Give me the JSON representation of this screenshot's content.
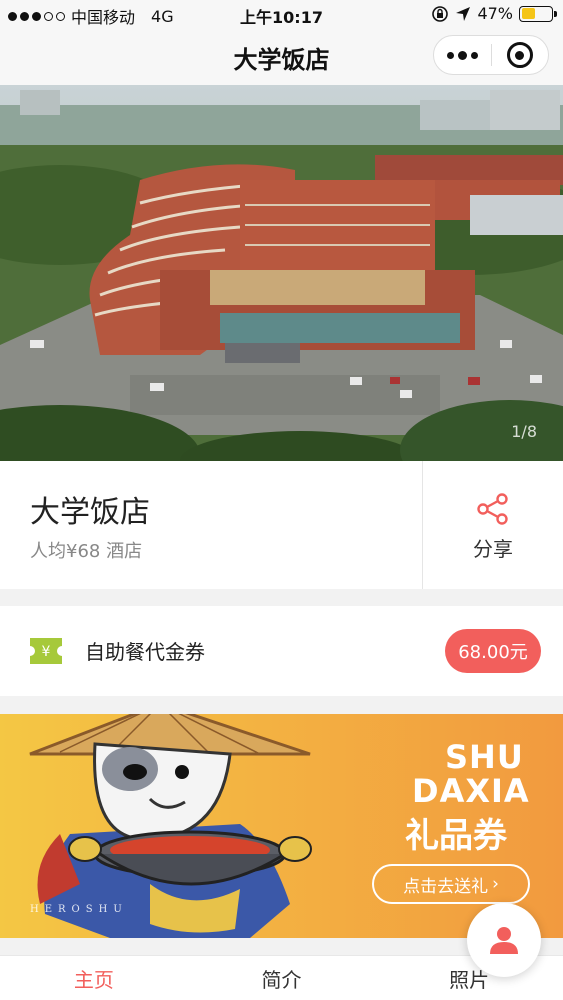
{
  "status_bar": {
    "carrier": "中国移动",
    "network": "4G",
    "time": "上午10:17",
    "battery": "47%",
    "battery_level": 0.47
  },
  "nav": {
    "title": "大学饭店"
  },
  "photo": {
    "counter": "1/8"
  },
  "info": {
    "name": "大学饭店",
    "meta": "人均¥68 酒店",
    "share_label": "分享"
  },
  "coupon": {
    "title": "自助餐代金券",
    "price": "68.00元",
    "icon_symbol": "¥"
  },
  "banner": {
    "line1": "SHU",
    "line2": "DAXIA",
    "line3": "礼品券",
    "cta": "点击去送礼",
    "cta_arrow": "›",
    "signature": "HEROSHU"
  },
  "tabs": [
    {
      "label": "主页",
      "active": true
    },
    {
      "label": "简介",
      "active": false
    },
    {
      "label": "照片",
      "active": false
    }
  ],
  "colors": {
    "accent": "#f25f5c",
    "coupon_icon": "#a6c93a",
    "banner_left": "#f4c744",
    "banner_right": "#f29a3f"
  }
}
